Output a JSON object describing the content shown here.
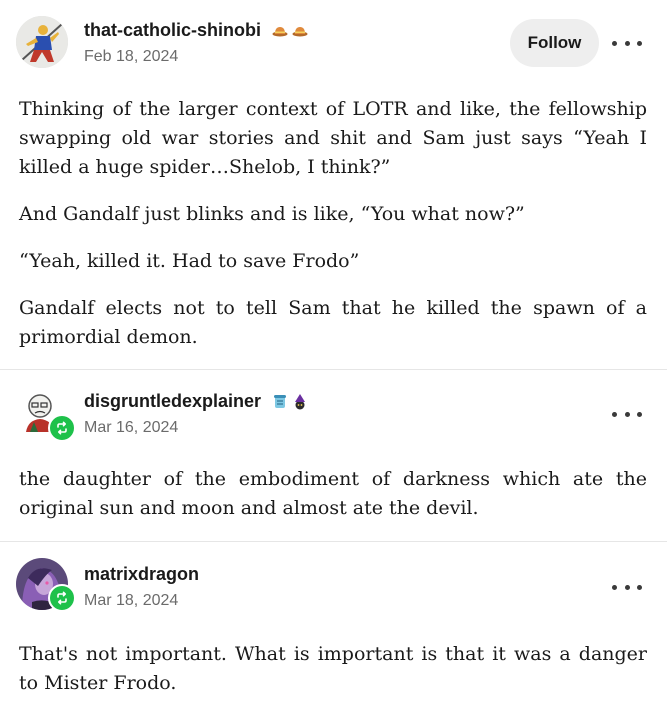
{
  "posts": [
    {
      "username": "that-catholic-shinobi",
      "date": "Feb 18, 2024",
      "follow_label": "Follow",
      "badges": [
        "hat-badge-icon",
        "hat-badge-icon"
      ],
      "paragraphs": [
        "Thinking of the larger context of LOTR and like, the fellowship swapping old war stories and shit and Sam just says “Yeah I killed a huge spider…Shelob, I think?”",
        "And Gandalf just blinks and is like, “You what now?”",
        "“Yeah, killed it. Had to save Frodo”",
        "Gandalf elects not to tell Sam that he killed the spawn of a primordial demon."
      ]
    },
    {
      "username": "disgruntledexplainer",
      "date": "Mar 16, 2024",
      "badges": [
        "scroll-badge-icon",
        "witch-badge-icon"
      ],
      "reblog_icon": "reblog-icon",
      "paragraphs": [
        "the daughter of the embodiment of darkness which ate the original sun and moon and almost ate the devil."
      ]
    },
    {
      "username": "matrixdragon",
      "date": "Mar 18, 2024",
      "reblog_icon": "reblog-icon",
      "paragraphs": [
        "That's not important. What is important is that it was a danger to Mister Frodo."
      ]
    }
  ],
  "colors": {
    "reblog": "#1ec14a",
    "follow_bg": "#eeeeee",
    "date": "#6b6b6b"
  }
}
